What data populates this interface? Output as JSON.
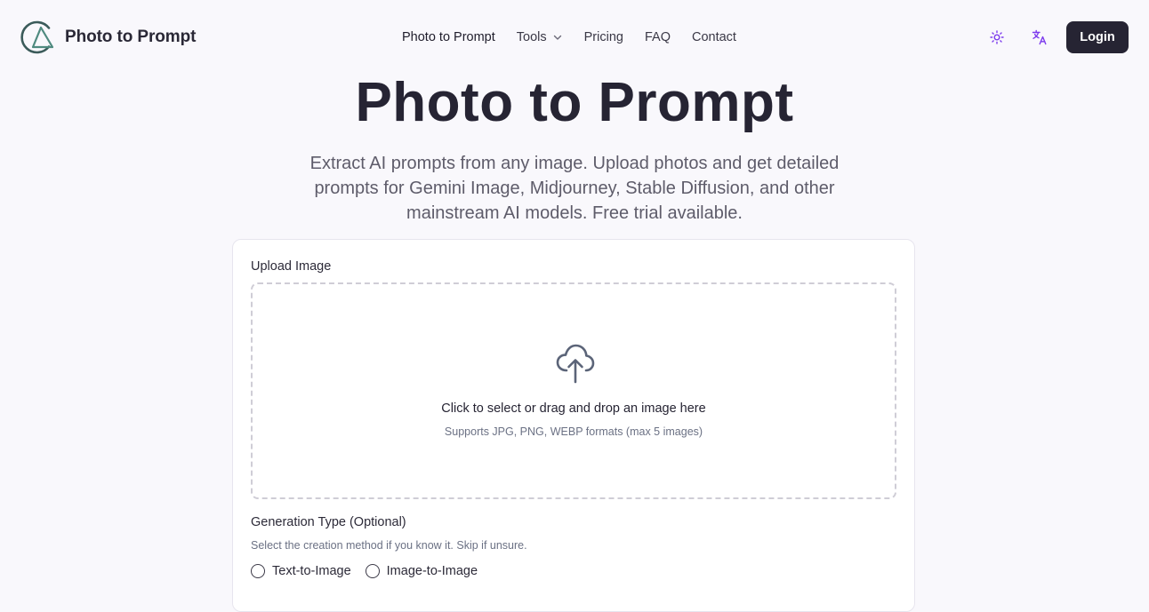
{
  "brand": {
    "name": "Photo to Prompt",
    "logo_icon": "triangle-in-circle-logo"
  },
  "nav": {
    "items": [
      {
        "label": "Photo to Prompt"
      },
      {
        "label": "Tools",
        "icon": "chevron-down-icon"
      },
      {
        "label": "Pricing"
      },
      {
        "label": "FAQ"
      },
      {
        "label": "Contact"
      }
    ]
  },
  "header_actions": {
    "theme_icon": "sun-icon",
    "language_icon": "translate-icon",
    "login_label": "Login"
  },
  "hero": {
    "title": "Photo to Prompt",
    "subtitle": "Extract AI prompts from any image. Upload photos and get detailed prompts for Gemini Image, Midjourney, Stable Diffusion, and other mainstream AI models. Free trial available."
  },
  "upload": {
    "label": "Upload Image",
    "icon": "cloud-upload-icon",
    "title": "Click to select or drag and drop an image here",
    "hint": "Supports JPG, PNG, WEBP formats (max 5 images)"
  },
  "generation": {
    "label": "Generation Type (Optional)",
    "description": "Select the creation method if you know it. Skip if unsure.",
    "options": [
      {
        "label": "Text-to-Image",
        "selected": false
      },
      {
        "label": "Image-to-Image",
        "selected": false
      }
    ]
  },
  "colors": {
    "primary_button": "#262433",
    "accent_purple": "#7c3aed",
    "page_bg": "#f9f8fc"
  }
}
